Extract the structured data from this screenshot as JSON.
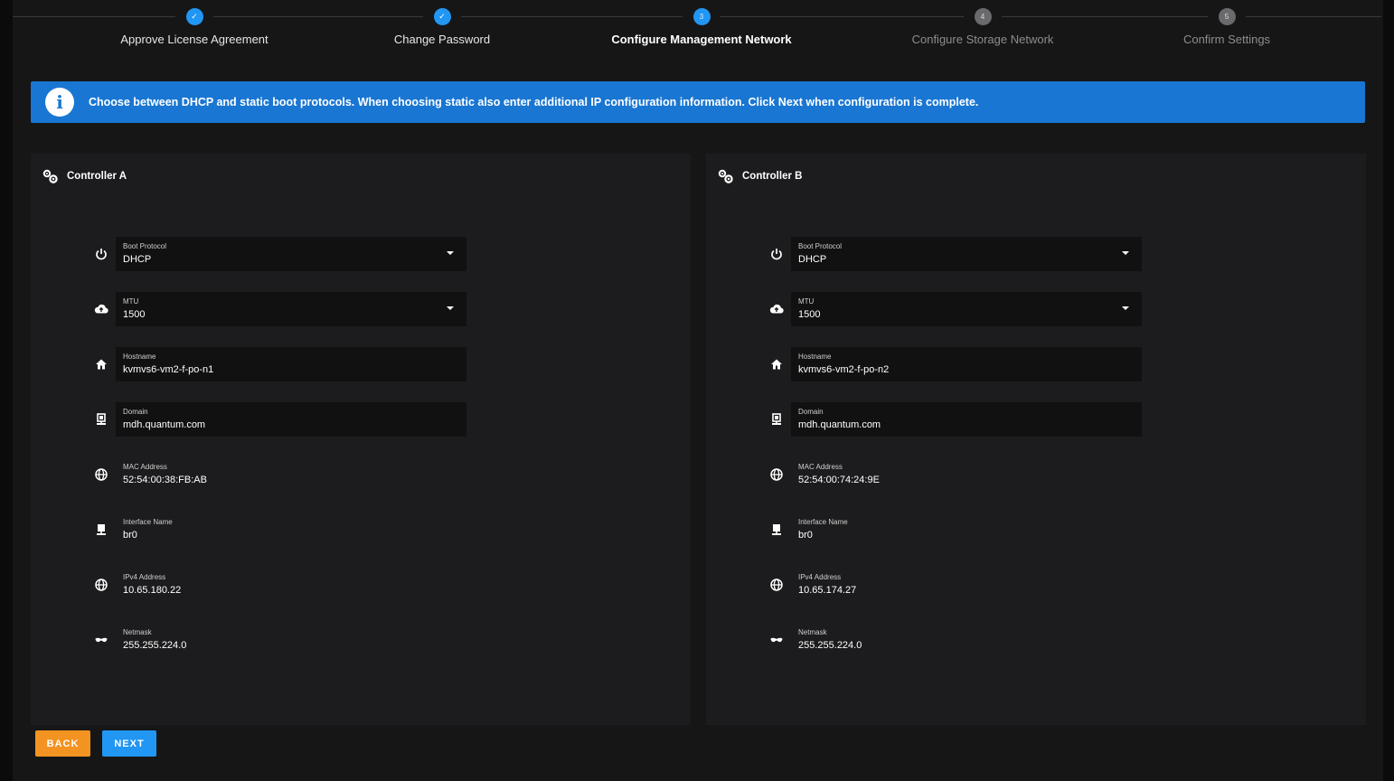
{
  "stepper": {
    "steps": [
      {
        "label": "Approve License Agreement",
        "state": "done",
        "marker": "✓"
      },
      {
        "label": "Change Password",
        "state": "done",
        "marker": "✓"
      },
      {
        "label": "Configure Management Network",
        "state": "active",
        "marker": "3"
      },
      {
        "label": "Configure Storage Network",
        "state": "pending",
        "marker": "4"
      },
      {
        "label": "Confirm Settings",
        "state": "pending",
        "marker": "5"
      }
    ]
  },
  "banner": {
    "icon": "info-icon",
    "text": "Choose between DHCP and static boot protocols. When choosing static also enter additional IP configuration information. Click Next when configuration is complete."
  },
  "controllers": [
    {
      "title": "Controller A",
      "fields": {
        "boot_protocol": {
          "label": "Boot Protocol",
          "value": "DHCP"
        },
        "mtu": {
          "label": "MTU",
          "value": "1500"
        },
        "hostname": {
          "label": "Hostname",
          "value": "kvmvs6-vm2-f-po-n1"
        },
        "domain": {
          "label": "Domain",
          "value": "mdh.quantum.com"
        },
        "mac": {
          "label": "MAC Address",
          "value": "52:54:00:38:FB:AB"
        },
        "interface": {
          "label": "Interface Name",
          "value": "br0"
        },
        "ipv4": {
          "label": "IPv4 Address",
          "value": "10.65.180.22"
        },
        "netmask": {
          "label": "Netmask",
          "value": "255.255.224.0"
        }
      }
    },
    {
      "title": "Controller B",
      "fields": {
        "boot_protocol": {
          "label": "Boot Protocol",
          "value": "DHCP"
        },
        "mtu": {
          "label": "MTU",
          "value": "1500"
        },
        "hostname": {
          "label": "Hostname",
          "value": "kvmvs6-vm2-f-po-n2"
        },
        "domain": {
          "label": "Domain",
          "value": "mdh.quantum.com"
        },
        "mac": {
          "label": "MAC Address",
          "value": "52:54:00:74:24:9E"
        },
        "interface": {
          "label": "Interface Name",
          "value": "br0"
        },
        "ipv4": {
          "label": "IPv4 Address",
          "value": "10.65.174.27"
        },
        "netmask": {
          "label": "Netmask",
          "value": "255.255.224.0"
        }
      }
    }
  ],
  "buttons": {
    "back": "BACK",
    "next": "NEXT"
  },
  "colors": {
    "accent": "#2196f3",
    "banner": "#1976d2",
    "back": "#f39321"
  }
}
